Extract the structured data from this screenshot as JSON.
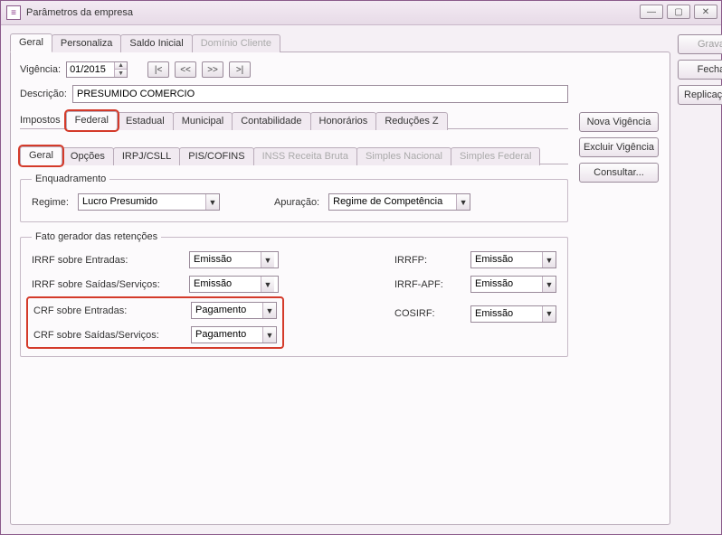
{
  "window": {
    "title": "Parâmetros da empresa"
  },
  "main_tabs": {
    "geral": "Geral",
    "personaliza": "Personaliza",
    "saldo_inicial": "Saldo Inicial",
    "dominio_cliente": "Domínio Cliente"
  },
  "top": {
    "vigencia_label": "Vigência:",
    "vigencia_value": "01/2015",
    "nav_first": "|<",
    "nav_prev": "<<",
    "nav_next": ">>",
    "nav_last": ">|",
    "descricao_label": "Descrição:",
    "descricao_value": "PRESUMIDO COMERCIO",
    "impostos_label": "Impostos"
  },
  "imposto_tabs": {
    "federal": "Federal",
    "estadual": "Estadual",
    "municipal": "Municipal",
    "contabilidade": "Contabilidade",
    "honorarios": "Honorários",
    "reducoes_z": "Reduções Z"
  },
  "federal_subtabs": {
    "geral": "Geral",
    "opcoes": "Opções",
    "irpj_csll": "IRPJ/CSLL",
    "pis_cofins": "PIS/COFINS",
    "inss_receita": "INSS Receita Bruta",
    "simples_nacional": "Simples Nacional",
    "simples_federal": "Simples Federal"
  },
  "enquadramento": {
    "legend": "Enquadramento",
    "regime_label": "Regime:",
    "regime_value": "Lucro Presumido",
    "apuracao_label": "Apuração:",
    "apuracao_value": "Regime de Competência"
  },
  "fato": {
    "legend": "Fato gerador das retenções",
    "irrf_entradas_label": "IRRF sobre Entradas:",
    "irrf_entradas_value": "Emissão",
    "irrf_saidas_label": "IRRF sobre Saídas/Serviços:",
    "irrf_saidas_value": "Emissão",
    "crf_entradas_label": "CRF sobre Entradas:",
    "crf_entradas_value": "Pagamento",
    "crf_saidas_label": "CRF sobre Saídas/Serviços:",
    "crf_saidas_value": "Pagamento",
    "irrfp_label": "IRRFP:",
    "irrfp_value": "Emissão",
    "irrf_apf_label": "IRRF-APF:",
    "irrf_apf_value": "Emissão",
    "cosirf_label": "COSIRF:",
    "cosirf_value": "Emissão"
  },
  "side_buttons": {
    "nova_vigencia": "Nova Vigência",
    "excluir_vigencia": "Excluir Vigência",
    "consultar": "Consultar..."
  },
  "right_buttons": {
    "gravar": "Gravar",
    "fechar": "Fechar",
    "replicacao": "Replicação..."
  }
}
